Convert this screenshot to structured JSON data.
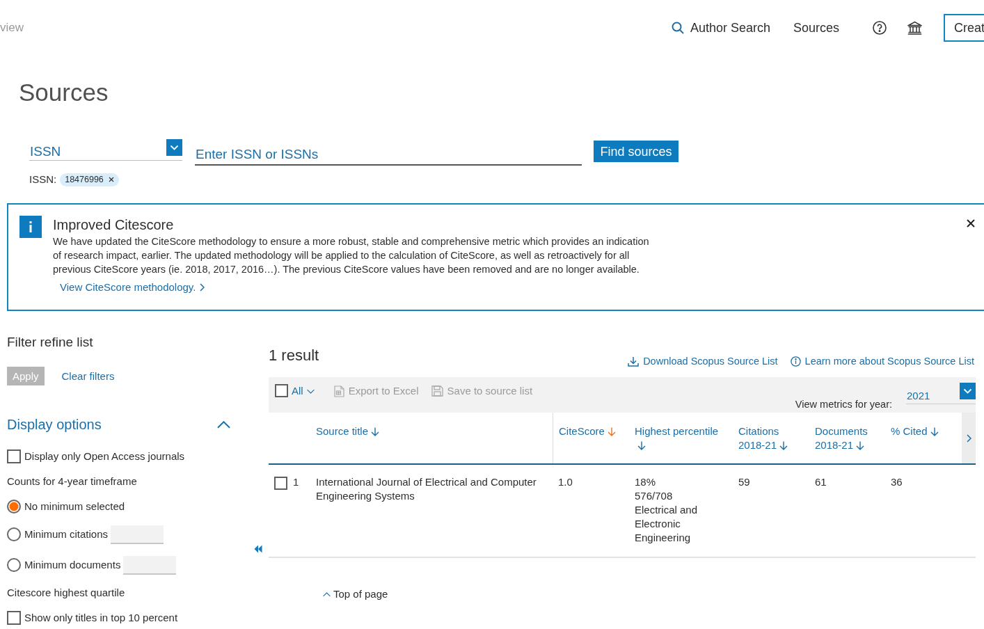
{
  "header": {
    "back_link": "view",
    "author_search_link": "Author Search",
    "sources_link": "Sources",
    "create_button": "Creat"
  },
  "page_title": "Sources",
  "search": {
    "field_type": "ISSN",
    "placeholder": "Enter ISSN or ISSNs",
    "button": "Find sources",
    "applied_label": "ISSN:",
    "applied_values": [
      "18476996"
    ]
  },
  "notice": {
    "title": "Improved Citescore",
    "text": "We have updated the CiteScore methodology to ensure a more robust, stable and comprehensive metric which provides an indication of research impact, earlier. The updated methodology will be applied to the calculation of CiteScore, as well as retroactively for all previous CiteScore years (ie. 2018, 2017, 2016…). The previous CiteScore values have been removed and are no longer available.",
    "link": "View CiteScore methodology."
  },
  "filters": {
    "title": "Filter refine list",
    "apply_button": {
      "label": "Apply",
      "disabled": true
    },
    "clear_link": "Clear filters",
    "display_options": {
      "title": "Display options",
      "expanded": true,
      "open_access": {
        "label": "Display only Open Access journals",
        "checked": false
      },
      "counts": {
        "title": "Counts for 4-year timeframe",
        "options": [
          {
            "kind": "plain",
            "label": "No minimum selected",
            "selected": true
          },
          {
            "kind": "with_input",
            "label": "Minimum citations",
            "selected": false
          },
          {
            "kind": "with_input",
            "label": "Minimum documents",
            "selected": false
          }
        ]
      },
      "quartile": {
        "title": "Citescore highest quartile",
        "top_ten": {
          "label": "Show only titles in top 10 percent",
          "checked": false
        }
      }
    }
  },
  "results": {
    "count": "1 result",
    "download_link": "Download Scopus Source List",
    "learn_more_link": "Learn more about Scopus Source List",
    "toolbar": {
      "select_all": {
        "label": "All",
        "checked": false
      },
      "actions": [
        {
          "label": "Export to Excel",
          "disabled": true
        },
        {
          "label": "Save to source list",
          "disabled": true
        }
      ],
      "year_label": "View metrics for year:",
      "year": "2021"
    },
    "table": {
      "columns": [
        {
          "label": "Source title",
          "sorted": false
        },
        {
          "label": "CiteScore",
          "sorted": true
        },
        {
          "label": "Highest percentile",
          "sorted": false
        },
        {
          "label": "Citations 2018-21",
          "sorted": false
        },
        {
          "label": "Documents 2018-21",
          "sorted": false
        },
        {
          "label": "% Cited",
          "sorted": false
        }
      ],
      "rows": [
        {
          "checked": false,
          "number": "1",
          "source_title": "International Journal of Electrical and Computer Engineering Systems",
          "citescore": "1.0",
          "percentile": "18%",
          "rank": "576/708",
          "subject_area": "Electrical and Electronic Engineering",
          "citations": "59",
          "documents": "61",
          "percent_cited": "36"
        }
      ]
    },
    "top_link": "Top of page"
  }
}
